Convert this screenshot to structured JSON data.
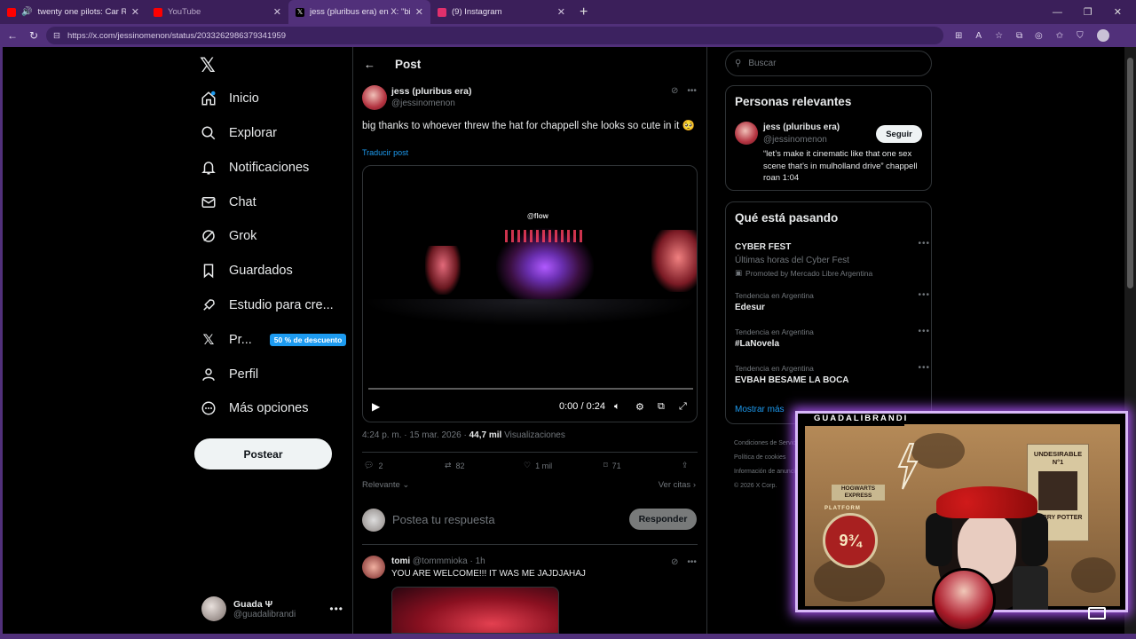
{
  "browser": {
    "tabs": [
      {
        "title": "twenty one pilots: Car Radio [",
        "favicon_color": "#ff0000",
        "state": "normal"
      },
      {
        "title": "YouTube",
        "favicon_color": "#ff0000",
        "state": "dim"
      },
      {
        "title": "jess (pluribus era) en X: \"big thanks",
        "favicon_color": "#000000",
        "state": "active"
      },
      {
        "title": "(9) Instagram",
        "favicon_color": "#e1306c",
        "state": "normal"
      }
    ],
    "tab_close": "✕",
    "new_tab": "+",
    "url": "https://x.com/jessinomenon/status/2033262986379341959"
  },
  "x": {
    "nav": [
      {
        "label": "Inicio",
        "icon": "home-icon"
      },
      {
        "label": "Explorar",
        "icon": "search-icon"
      },
      {
        "label": "Notificaciones",
        "icon": "bell-icon"
      },
      {
        "label": "Chat",
        "icon": "mail-icon"
      },
      {
        "label": "Grok",
        "icon": "grok-icon"
      },
      {
        "label": "Guardados",
        "icon": "bookmark-icon"
      },
      {
        "label": "Estudio para cre...",
        "icon": "rocket-icon"
      },
      {
        "label": "Pr...",
        "icon": "x-icon",
        "badge": "50 % de descuento"
      },
      {
        "label": "Perfil",
        "icon": "person-icon"
      },
      {
        "label": "Más opciones",
        "icon": "more-circle-icon"
      }
    ],
    "post_button": "Postear",
    "profile": {
      "name": "Guada Ψ",
      "handle": "@guadalibrandi"
    }
  },
  "main": {
    "header_title": "Post",
    "post": {
      "author_name": "jess (pluribus era)",
      "author_handle": "@jessinomenon",
      "text": "big thanks to whoever threw the hat for chappell she looks so cute in it 🥺",
      "translate": "Traducir post",
      "video_overlay": "@flow",
      "video_time": "0:00 / 0:24",
      "timestamp": "4:24 p. m. · 15 mar. 2026 · ",
      "views_count": "44,7 mil",
      "views_label": " Visualizaciones",
      "replies": "2",
      "reposts": "82",
      "likes": "1 mil",
      "bookmarks": "71",
      "sort_label": "Relevante",
      "quotes_label": "Ver citas"
    },
    "reply_placeholder": "Postea tu respuesta",
    "reply_button": "Responder",
    "comment": {
      "name": "tomi",
      "handle": "@tommmioka · 1h",
      "text": "YOU ARE WELCOME!!! IT WAS ME JAJDJAHAJ"
    }
  },
  "right": {
    "search_placeholder": "Buscar",
    "relevant": {
      "title": "Personas relevantes",
      "name": "jess (pluribus era)",
      "handle": "@jessinomenon",
      "follow": "Seguir",
      "bio": "“let’s make it cinematic like that one sex scene that’s in mulholland drive” chappell roan 1:04"
    },
    "trending": {
      "title": "Qué está pasando",
      "items": [
        {
          "name": "CYBER FEST",
          "sub": "Últimas horas del Cyber Fest",
          "promo": "Promoted by Mercado Libre Argentina"
        },
        {
          "context": "Tendencia en Argentina",
          "name": "Edesur"
        },
        {
          "context": "Tendencia en Argentina",
          "name": "#LaNovela"
        },
        {
          "context": "Tendencia en Argentina",
          "name": "EVBAH BESAME LA BOCA"
        }
      ],
      "show_more": "Mostrar más"
    },
    "footer": [
      "Condiciones de Servicio",
      "Política de cookies",
      "Información de anuncios",
      "© 2026 X Corp."
    ]
  },
  "stream": {
    "cam_label": "GUADALIBRANDI",
    "poster_title": "UNDESIRABLE N°1",
    "poster_name": "HARRY POTTER",
    "platform_number": "9¾",
    "platform_text": "PLATFORM",
    "hogwarts_sign": "HOGWARTS EXPRESS"
  }
}
